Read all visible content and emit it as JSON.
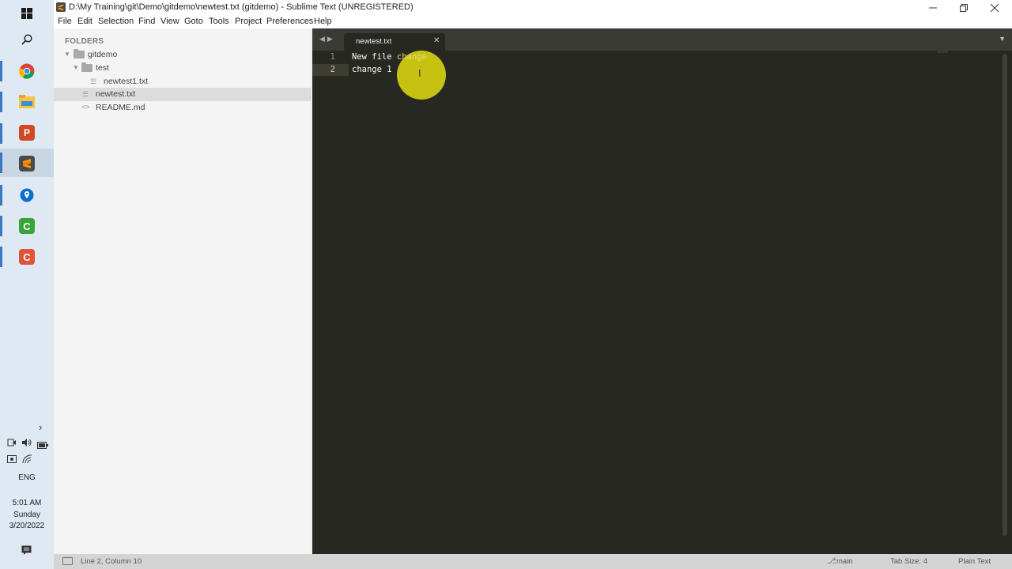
{
  "window": {
    "title": "D:\\My Training\\git\\Demo\\gitdemo\\newtest.txt (gitdemo) - Sublime Text (UNREGISTERED)"
  },
  "menu": [
    "File",
    "Edit",
    "Selection",
    "Find",
    "View",
    "Goto",
    "Tools",
    "Project",
    "Preferences",
    "Help"
  ],
  "sidebar": {
    "title": "FOLDERS",
    "tree": [
      {
        "label": "gitdemo",
        "type": "folder",
        "expanded": true,
        "level": 0
      },
      {
        "label": "test",
        "type": "folder",
        "expanded": true,
        "level": 1
      },
      {
        "label": "newtest1.txt",
        "type": "file",
        "level": 2
      },
      {
        "label": "newtest.txt",
        "type": "file",
        "level": 1,
        "selected": true
      },
      {
        "label": "README.md",
        "type": "code-file",
        "level": 1
      }
    ]
  },
  "tabs": [
    {
      "label": "newtest.txt",
      "active": true
    }
  ],
  "editor": {
    "lines": [
      {
        "num": "1",
        "prefix": "New file ",
        "highlight": "change"
      },
      {
        "num": "2",
        "prefix": "change 1",
        "highlight": ""
      }
    ]
  },
  "statusbar": {
    "position": "Line 2, Column 10",
    "branch": "main",
    "tab_size": "Tab Size: 4",
    "syntax": "Plain Text"
  },
  "taskbar": {
    "language": "ENG",
    "time": "5:01 AM",
    "day": "Sunday",
    "date": "3/20/2022"
  },
  "colors": {
    "editor_bg": "#272822",
    "sidebar_bg": "#f4f4f4",
    "cursor_highlight": "#ded610"
  }
}
